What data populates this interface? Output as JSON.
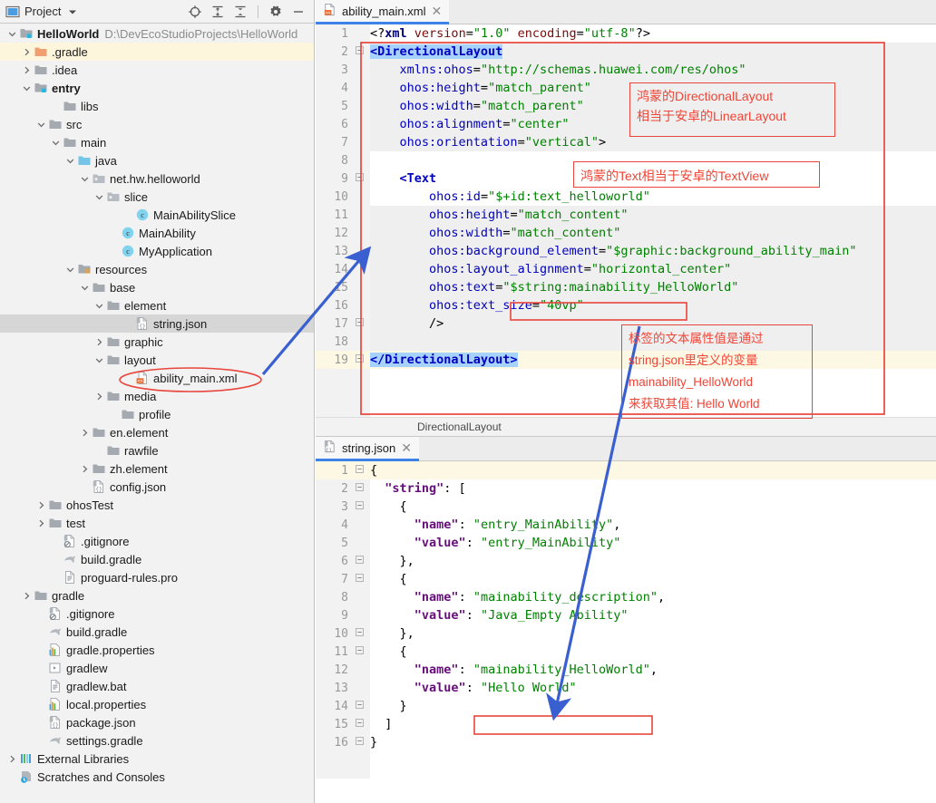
{
  "project_panel": {
    "title": "Project",
    "dropdown_icon": "chevron-down-icon",
    "toolbar_icons": [
      "locate-target-icon",
      "expand-all-icon",
      "collapse-all-icon",
      "settings-gear-icon",
      "minimize-icon"
    ],
    "tree": [
      {
        "indent": 0,
        "twist": "down",
        "icon": "module-folder",
        "label": "HelloWorld",
        "bold": true,
        "path": "D:\\DevEcoStudioProjects\\HelloWorld",
        "state": ""
      },
      {
        "indent": 1,
        "twist": "right",
        "icon": "folder-orange",
        "label": ".gradle",
        "bold": false,
        "path": "",
        "state": "sel-yellow"
      },
      {
        "indent": 1,
        "twist": "right",
        "icon": "folder",
        "label": ".idea",
        "bold": false,
        "path": "",
        "state": ""
      },
      {
        "indent": 1,
        "twist": "down",
        "icon": "module-folder",
        "label": "entry",
        "bold": true,
        "path": "",
        "state": ""
      },
      {
        "indent": 3,
        "twist": "none",
        "icon": "folder",
        "label": "libs",
        "bold": false,
        "path": "",
        "state": ""
      },
      {
        "indent": 2,
        "twist": "down",
        "icon": "folder",
        "label": "src",
        "bold": false,
        "path": "",
        "state": ""
      },
      {
        "indent": 3,
        "twist": "down",
        "icon": "folder",
        "label": "main",
        "bold": false,
        "path": "",
        "state": ""
      },
      {
        "indent": 4,
        "twist": "down",
        "icon": "folder-blue",
        "label": "java",
        "bold": false,
        "path": "",
        "state": ""
      },
      {
        "indent": 5,
        "twist": "down",
        "icon": "package",
        "label": "net.hw.helloworld",
        "bold": false,
        "path": "",
        "state": ""
      },
      {
        "indent": 6,
        "twist": "down",
        "icon": "package",
        "label": "slice",
        "bold": false,
        "path": "",
        "state": ""
      },
      {
        "indent": 8,
        "twist": "none",
        "icon": "class",
        "label": "MainAbilitySlice",
        "bold": false,
        "path": "",
        "state": ""
      },
      {
        "indent": 7,
        "twist": "none",
        "icon": "class",
        "label": "MainAbility",
        "bold": false,
        "path": "",
        "state": ""
      },
      {
        "indent": 7,
        "twist": "none",
        "icon": "class",
        "label": "MyApplication",
        "bold": false,
        "path": "",
        "state": ""
      },
      {
        "indent": 4,
        "twist": "down",
        "icon": "resources-folder",
        "label": "resources",
        "bold": false,
        "path": "",
        "state": ""
      },
      {
        "indent": 5,
        "twist": "down",
        "icon": "folder",
        "label": "base",
        "bold": false,
        "path": "",
        "state": ""
      },
      {
        "indent": 6,
        "twist": "down",
        "icon": "folder",
        "label": "element",
        "bold": false,
        "path": "",
        "state": ""
      },
      {
        "indent": 8,
        "twist": "none",
        "icon": "json-file",
        "label": "string.json",
        "bold": false,
        "path": "",
        "state": "sel-gray"
      },
      {
        "indent": 6,
        "twist": "right",
        "icon": "folder",
        "label": "graphic",
        "bold": false,
        "path": "",
        "state": ""
      },
      {
        "indent": 6,
        "twist": "down",
        "icon": "folder",
        "label": "layout",
        "bold": false,
        "path": "",
        "state": ""
      },
      {
        "indent": 8,
        "twist": "none",
        "icon": "xml-file",
        "label": "ability_main.xml",
        "bold": false,
        "path": "",
        "state": ""
      },
      {
        "indent": 6,
        "twist": "right",
        "icon": "folder",
        "label": "media",
        "bold": false,
        "path": "",
        "state": ""
      },
      {
        "indent": 7,
        "twist": "none",
        "icon": "folder",
        "label": "profile",
        "bold": false,
        "path": "",
        "state": ""
      },
      {
        "indent": 5,
        "twist": "right",
        "icon": "folder",
        "label": "en.element",
        "bold": false,
        "path": "",
        "state": ""
      },
      {
        "indent": 6,
        "twist": "none",
        "icon": "folder",
        "label": "rawfile",
        "bold": false,
        "path": "",
        "state": ""
      },
      {
        "indent": 5,
        "twist": "right",
        "icon": "folder",
        "label": "zh.element",
        "bold": false,
        "path": "",
        "state": ""
      },
      {
        "indent": 5,
        "twist": "none",
        "icon": "json-file",
        "label": "config.json",
        "bold": false,
        "path": "",
        "state": ""
      },
      {
        "indent": 2,
        "twist": "right",
        "icon": "folder",
        "label": "ohosTest",
        "bold": false,
        "path": "",
        "state": ""
      },
      {
        "indent": 2,
        "twist": "right",
        "icon": "folder",
        "label": "test",
        "bold": false,
        "path": "",
        "state": ""
      },
      {
        "indent": 3,
        "twist": "none",
        "icon": "gitignore-file",
        "label": ".gitignore",
        "bold": false,
        "path": "",
        "state": ""
      },
      {
        "indent": 3,
        "twist": "none",
        "icon": "gradle-file",
        "label": "build.gradle",
        "bold": false,
        "path": "",
        "state": ""
      },
      {
        "indent": 3,
        "twist": "none",
        "icon": "text-file",
        "label": "proguard-rules.pro",
        "bold": false,
        "path": "",
        "state": ""
      },
      {
        "indent": 1,
        "twist": "right",
        "icon": "folder",
        "label": "gradle",
        "bold": false,
        "path": "",
        "state": ""
      },
      {
        "indent": 2,
        "twist": "none",
        "icon": "gitignore-file",
        "label": ".gitignore",
        "bold": false,
        "path": "",
        "state": ""
      },
      {
        "indent": 2,
        "twist": "none",
        "icon": "gradle-file",
        "label": "build.gradle",
        "bold": false,
        "path": "",
        "state": ""
      },
      {
        "indent": 2,
        "twist": "none",
        "icon": "properties-file",
        "label": "gradle.properties",
        "bold": false,
        "path": "",
        "state": ""
      },
      {
        "indent": 2,
        "twist": "none",
        "icon": "script-file",
        "label": "gradlew",
        "bold": false,
        "path": "",
        "state": ""
      },
      {
        "indent": 2,
        "twist": "none",
        "icon": "text-file",
        "label": "gradlew.bat",
        "bold": false,
        "path": "",
        "state": ""
      },
      {
        "indent": 2,
        "twist": "none",
        "icon": "properties-file",
        "label": "local.properties",
        "bold": false,
        "path": "",
        "state": ""
      },
      {
        "indent": 2,
        "twist": "none",
        "icon": "json-file",
        "label": "package.json",
        "bold": false,
        "path": "",
        "state": ""
      },
      {
        "indent": 2,
        "twist": "none",
        "icon": "gradle-file",
        "label": "settings.gradle",
        "bold": false,
        "path": "",
        "state": ""
      },
      {
        "indent": 0,
        "twist": "right",
        "icon": "libraries",
        "label": "External Libraries",
        "bold": false,
        "path": "",
        "state": ""
      },
      {
        "indent": 0,
        "twist": "none",
        "icon": "scratches",
        "label": "Scratches and Consoles",
        "bold": false,
        "path": "",
        "state": ""
      }
    ]
  },
  "xml_editor": {
    "tab": {
      "label": "ability_main.xml",
      "icon": "xml-file-icon",
      "close": "✕"
    },
    "breadcrumb": "DirectionalLayout",
    "lines": [
      {
        "n": "1",
        "fold": "",
        "hl": false,
        "text": "<?xml version=\"1.0\" encoding=\"utf-8\"?>"
      },
      {
        "n": "2",
        "fold": "-",
        "hl": false,
        "text": "<DirectionalLayout"
      },
      {
        "n": "3",
        "fold": "",
        "hl": false,
        "text": "    xmlns:ohos=\"http://schemas.huawei.com/res/ohos\""
      },
      {
        "n": "4",
        "fold": "",
        "hl": false,
        "text": "    ohos:height=\"match_parent\""
      },
      {
        "n": "5",
        "fold": "",
        "hl": false,
        "text": "    ohos:width=\"match_parent\""
      },
      {
        "n": "6",
        "fold": "",
        "hl": false,
        "text": "    ohos:alignment=\"center\""
      },
      {
        "n": "7",
        "fold": "",
        "hl": false,
        "text": "    ohos:orientation=\"vertical\">"
      },
      {
        "n": "8",
        "fold": "",
        "hl": false,
        "text": ""
      },
      {
        "n": "9",
        "fold": "-",
        "hl": false,
        "text": "    <Text"
      },
      {
        "n": "10",
        "fold": "",
        "hl": false,
        "text": "        ohos:id=\"$+id:text_helloworld\""
      },
      {
        "n": "11",
        "fold": "",
        "hl": false,
        "text": "        ohos:height=\"match_content\""
      },
      {
        "n": "12",
        "fold": "",
        "hl": false,
        "text": "        ohos:width=\"match_content\""
      },
      {
        "n": "13",
        "fold": "",
        "hl": false,
        "text": "        ohos:background_element=\"$graphic:background_ability_main\""
      },
      {
        "n": "14",
        "fold": "",
        "hl": false,
        "text": "        ohos:layout_alignment=\"horizontal_center\""
      },
      {
        "n": "15",
        "fold": "",
        "hl": false,
        "text": "        ohos:text=\"$string:mainability_HelloWorld\""
      },
      {
        "n": "16",
        "fold": "",
        "hl": false,
        "text": "        ohos:text_size=\"40vp\""
      },
      {
        "n": "17",
        "fold": "-",
        "hl": false,
        "text": "        />"
      },
      {
        "n": "18",
        "fold": "",
        "hl": false,
        "text": ""
      },
      {
        "n": "19",
        "fold": "-",
        "hl": true,
        "text": "</DirectionalLayout>"
      }
    ]
  },
  "json_editor": {
    "tab": {
      "label": "string.json",
      "icon": "json-file-icon",
      "close": "✕"
    },
    "lines": [
      {
        "n": "1",
        "fold": "-",
        "hl": true,
        "text": "{"
      },
      {
        "n": "2",
        "fold": "-",
        "hl": false,
        "text": "  \"string\": ["
      },
      {
        "n": "3",
        "fold": "-",
        "hl": false,
        "text": "    {"
      },
      {
        "n": "4",
        "fold": "",
        "hl": false,
        "text": "      \"name\": \"entry_MainAbility\","
      },
      {
        "n": "5",
        "fold": "",
        "hl": false,
        "text": "      \"value\": \"entry_MainAbility\""
      },
      {
        "n": "6",
        "fold": "-",
        "hl": false,
        "text": "    },"
      },
      {
        "n": "7",
        "fold": "-",
        "hl": false,
        "text": "    {"
      },
      {
        "n": "8",
        "fold": "",
        "hl": false,
        "text": "      \"name\": \"mainability_description\","
      },
      {
        "n": "9",
        "fold": "",
        "hl": false,
        "text": "      \"value\": \"Java_Empty Ability\""
      },
      {
        "n": "10",
        "fold": "-",
        "hl": false,
        "text": "    },"
      },
      {
        "n": "11",
        "fold": "-",
        "hl": false,
        "text": "    {"
      },
      {
        "n": "12",
        "fold": "",
        "hl": false,
        "text": "      \"name\": \"mainability_HelloWorld\","
      },
      {
        "n": "13",
        "fold": "",
        "hl": false,
        "text": "      \"value\": \"Hello World\""
      },
      {
        "n": "14",
        "fold": "-",
        "hl": false,
        "text": "    }"
      },
      {
        "n": "15",
        "fold": "-",
        "hl": false,
        "text": "  ]"
      },
      {
        "n": "16",
        "fold": "-",
        "hl": false,
        "text": "}"
      }
    ]
  },
  "annotations": {
    "callout_1": "鸿蒙的DirectionalLayout\n相当于安卓的LinearLayout",
    "callout_2": "鸿蒙的Text相当于安卓的TextView",
    "callout_3": "标签的文本属性值是通过\nstring.json里定义的变量\nmainability_HelloWorld\n来获取其值: Hello World",
    "accent_red": "#e8453c",
    "accent_blue": "#3a5fd0"
  }
}
